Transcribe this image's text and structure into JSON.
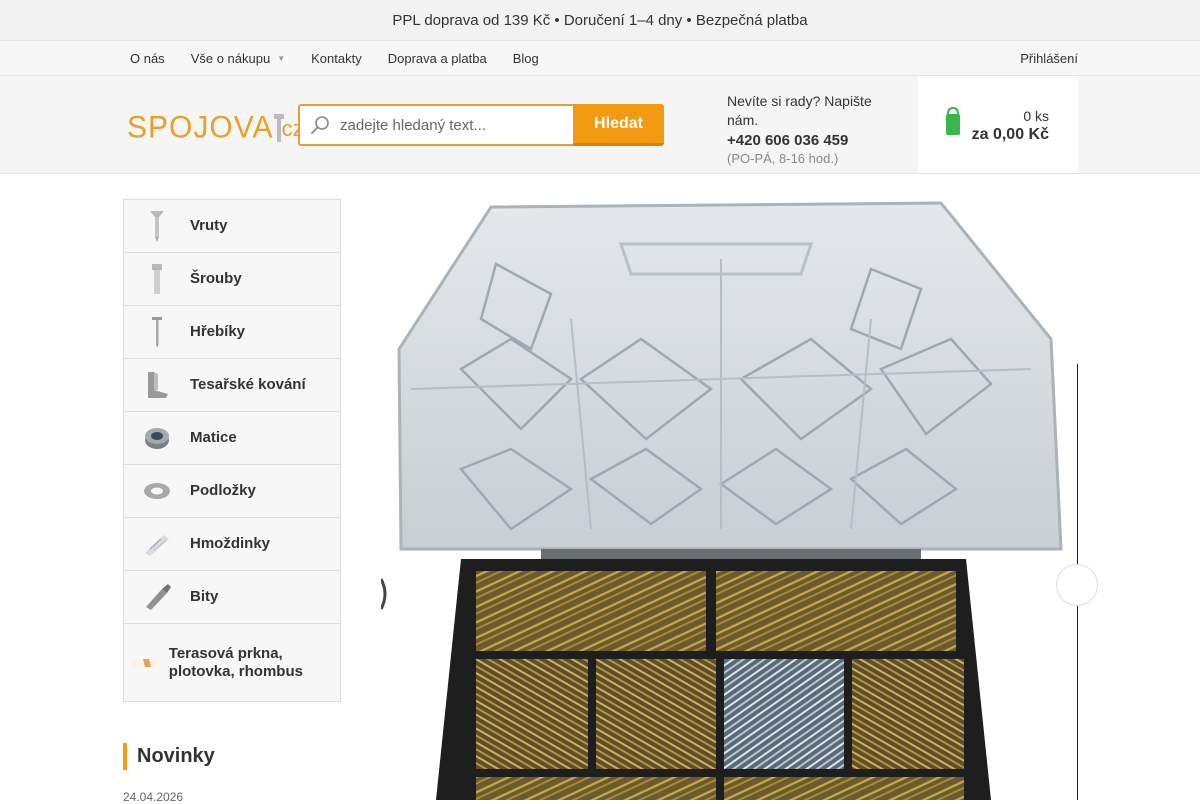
{
  "topbar": {
    "text": " PPL doprava od 139 Kč •  Doručení 1–4 dny •  Bezpečná platba"
  },
  "nav": {
    "items": [
      "O nás",
      "Vše o nákupu",
      "Kontakty",
      "Doprava a platba",
      "Blog"
    ],
    "login_label": "Přihlášení"
  },
  "header": {
    "logo_text": "SPOJOVA",
    "logo_suffix": ".cz",
    "search_placeholder": "zadejte hledaný text...",
    "search_button": "Hledat",
    "help_text": "Nevíte si rady? Napište nám.",
    "help_phone": "+420 606 036 459",
    "help_hours": "(PO-PÁ, 8-16 hod.)",
    "cart_qty": "0 ks",
    "cart_total": "za 0,00 Kč"
  },
  "categories": [
    {
      "label": "Vruty",
      "icon": "screw-icon"
    },
    {
      "label": "Šrouby",
      "icon": "bolt-icon"
    },
    {
      "label": "Hřebíky",
      "icon": "nail-icon"
    },
    {
      "label": "Tesařské kování",
      "icon": "bracket-icon"
    },
    {
      "label": "Matice",
      "icon": "nut-icon"
    },
    {
      "label": "Podložky",
      "icon": "washer-icon"
    },
    {
      "label": "Hmoždinky",
      "icon": "anchor-icon"
    },
    {
      "label": "Bity",
      "icon": "bit-icon"
    },
    {
      "label": "Terasová prkna, plotovka, rhombus",
      "icon": "plank-icon"
    }
  ],
  "news": {
    "title": "Novinky",
    "date": "24.04.2026"
  },
  "colors": {
    "accent": "#f39a12",
    "logo": "#e5a12a"
  }
}
